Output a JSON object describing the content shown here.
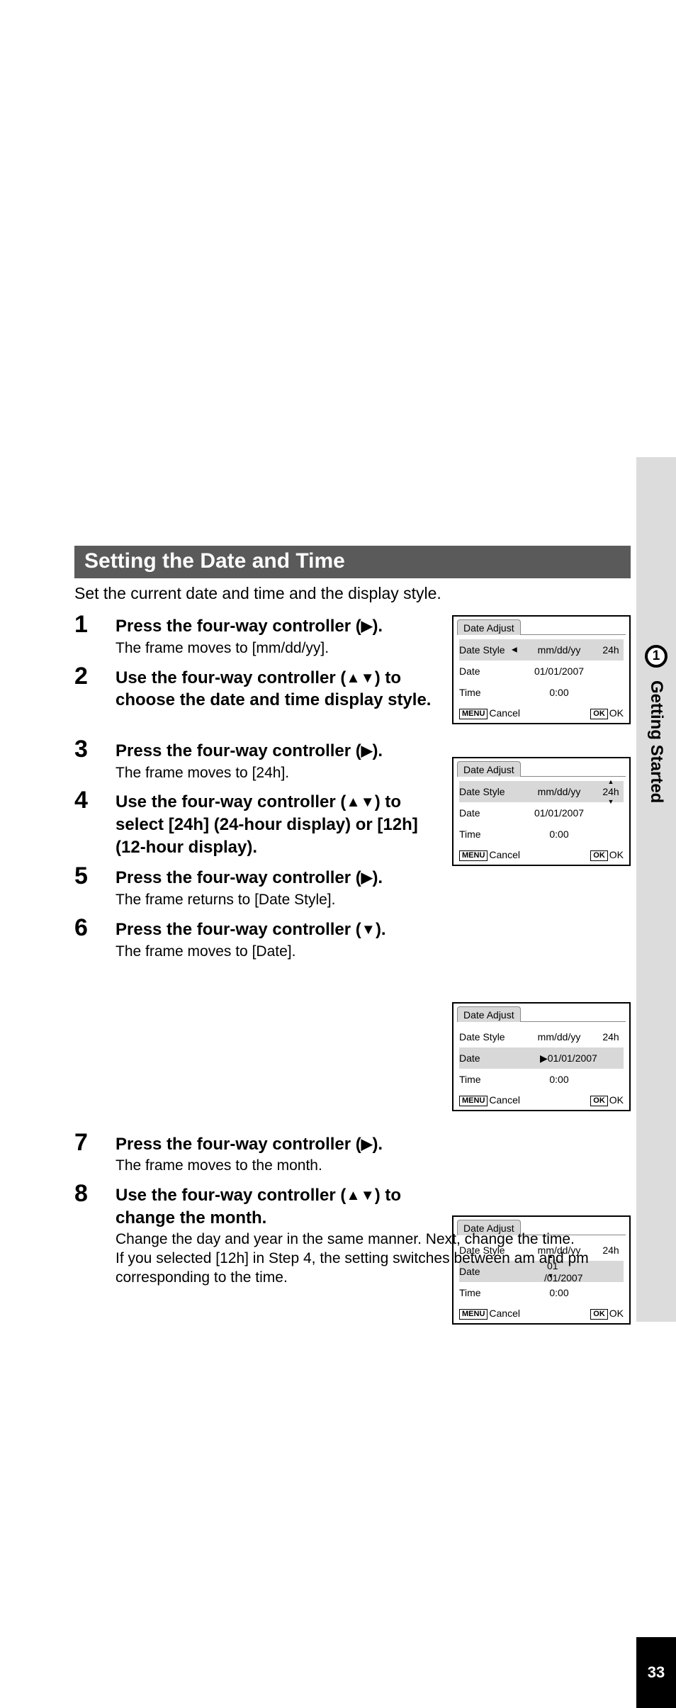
{
  "chapter": {
    "number": "1",
    "title": "Getting Started",
    "page": "33"
  },
  "heading": "Setting the Date and Time",
  "intro": "Set the current date and time and the display style.",
  "steps": {
    "s1": {
      "num": "1",
      "title_before": "Press the four-way controller (",
      "title_after": ").",
      "sub": "The frame moves to [mm/dd/yy]."
    },
    "s2": {
      "num": "2",
      "title_before": "Use the four-way controller (",
      "title_after": ") to choose the date and time display style."
    },
    "s3": {
      "num": "3",
      "title_before": "Press the four-way controller (",
      "title_after": ").",
      "sub": "The frame moves to [24h]."
    },
    "s4": {
      "num": "4",
      "title_before": "Use the four-way controller (",
      "title_after": ") to select [24h] (24-hour display) or [12h] (12-hour display)."
    },
    "s5": {
      "num": "5",
      "title_before": "Press the four-way controller (",
      "title_after": ").",
      "sub": "The frame returns to [Date Style]."
    },
    "s6": {
      "num": "6",
      "title_before": "Press the four-way controller (",
      "title_after": ").",
      "sub": "The frame moves to [Date]."
    },
    "s7": {
      "num": "7",
      "title_before": "Press the four-way controller (",
      "title_after": ").",
      "sub": "The frame moves to the month."
    },
    "s8": {
      "num": "8",
      "title_before": "Use the four-way controller (",
      "title_after": ") to change the month.",
      "sub": "Change the day and year in the same manner. Next, change the time.\nIf you selected [12h] in Step 4, the setting switches between am and pm corresponding to the time."
    }
  },
  "lcd": {
    "tab": "Date Adjust",
    "row_datestyle": "Date Style",
    "row_date": "Date",
    "row_time": "Time",
    "val_mmddyy": "mm/dd/yy",
    "val_24h": "24h",
    "val_date": "01/01/2007",
    "val_time": "0:00",
    "menu": "MENU",
    "cancel": "Cancel",
    "ok_btn": "OK",
    "ok": "OK",
    "month_seg": "01",
    "rest_seg": "/01/2007",
    "date_arrow_prefix": "▶01/01/2007"
  }
}
